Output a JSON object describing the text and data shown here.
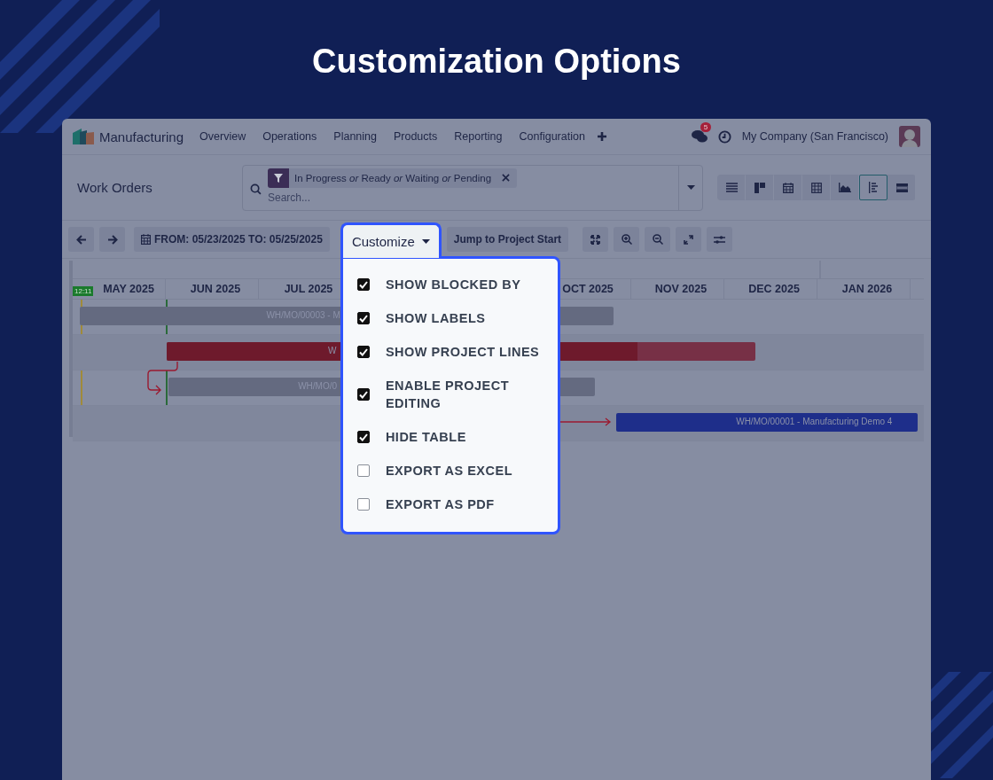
{
  "title": "Customization Options",
  "navbar": {
    "app_name": "Manufacturing",
    "menu": [
      "Overview",
      "Operations",
      "Planning",
      "Products",
      "Reporting",
      "Configuration"
    ],
    "message_count": "5",
    "company": "My Company (San Francisco)"
  },
  "control_panel": {
    "breadcrumb": "Work Orders",
    "filter_facet": "In Progress *or* Ready *or* Waiting *or* Pending",
    "search": {
      "placeholder": "Search..."
    },
    "views": [
      {
        "kind": "list",
        "selected": false
      },
      {
        "kind": "kanban",
        "selected": false
      },
      {
        "kind": "calendar",
        "selected": false
      },
      {
        "kind": "pivot",
        "selected": false
      },
      {
        "kind": "graph",
        "selected": false
      },
      {
        "kind": "gantt",
        "selected": true
      },
      {
        "kind": "map",
        "selected": false
      }
    ]
  },
  "toolbar": {
    "date_range": "FROM: 05/23/2025 TO: 05/25/2025",
    "customize": "Customize",
    "jump": "Jump to Project Start"
  },
  "customize_menu": [
    {
      "label": "SHOW BLOCKED BY",
      "checked": true
    },
    {
      "label": "SHOW LABELS",
      "checked": true
    },
    {
      "label": "SHOW PROJECT LINES",
      "checked": true
    },
    {
      "label": "ENABLE PROJECT EDITING",
      "checked": true
    },
    {
      "label": "HIDE TABLE",
      "checked": true
    },
    {
      "label": "EXPORT AS EXCEL",
      "checked": false
    },
    {
      "label": "EXPORT AS PDF",
      "checked": false
    }
  ],
  "gantt": {
    "now_marker": "12:11",
    "months": [
      "MAY 2025",
      "JUN 2025",
      "JUL 2025",
      "OCT 2025",
      "NOV 2025",
      "DEC 2025",
      "JAN 2026"
    ],
    "bars": [
      {
        "label": "WH/MO/00003 - M",
        "color": "#646a80"
      },
      {
        "label": "W",
        "color": "#6e1a2c",
        "level": 0.8
      },
      {
        "label": "WH/MO/0",
        "color": "#646a80"
      },
      {
        "label": "WH/MO/00001 - Manufacturing Demo 4",
        "color": "#1e2e8a"
      }
    ]
  }
}
